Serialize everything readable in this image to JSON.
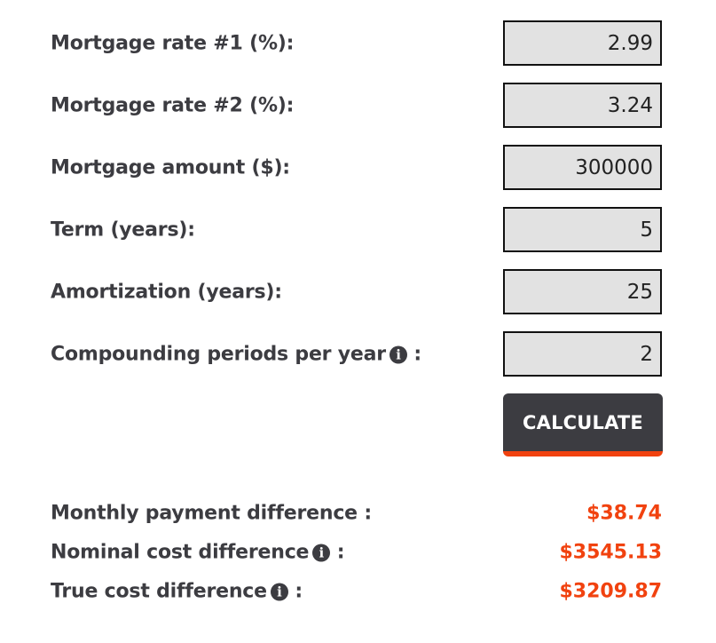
{
  "form": {
    "fields": [
      {
        "label": "Mortgage rate #1 (%):",
        "value": "2.99",
        "info": false
      },
      {
        "label": "Mortgage rate #2 (%):",
        "value": "3.24",
        "info": false
      },
      {
        "label": "Mortgage amount ($):",
        "value": "300000",
        "info": false
      },
      {
        "label": "Term (years):",
        "value": "5",
        "info": false
      },
      {
        "label": "Amortization (years):",
        "value": "25",
        "info": false
      },
      {
        "label": "Compounding periods per year",
        "suffix": " :",
        "value": "2",
        "info": true
      }
    ],
    "calculate_label": "CALCULATE"
  },
  "results": [
    {
      "label": "Monthly payment difference :",
      "value": "$38.74",
      "info": false
    },
    {
      "label": "Nominal cost difference",
      "suffix": " :",
      "value": "$3545.13",
      "info": true
    },
    {
      "label": "True cost difference",
      "suffix": " :",
      "value": "$3209.87",
      "info": true
    }
  ],
  "icons": {
    "info": "i"
  },
  "colors": {
    "accent": "#f1420f",
    "button_bg": "#3c3c41",
    "text": "#3c3c41",
    "field_bg": "#e2e2e2"
  }
}
